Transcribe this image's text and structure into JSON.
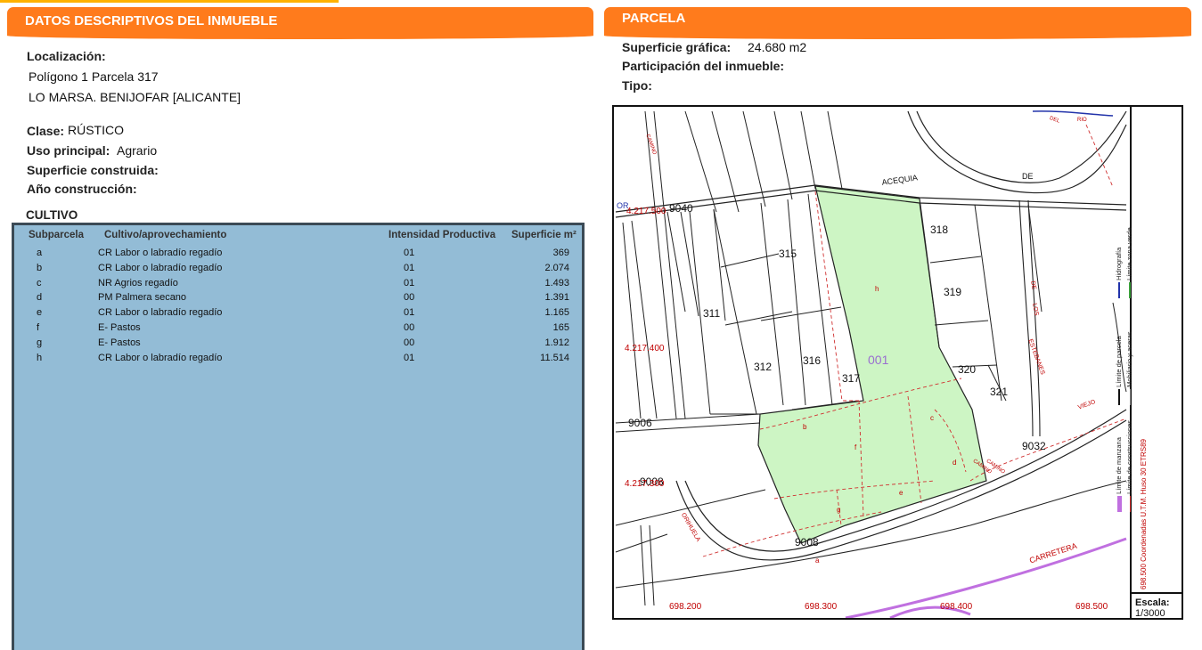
{
  "left_header": "DATOS DESCRIPTIVOS DEL INMUEBLE",
  "right_header": "PARCELA",
  "localizacion": {
    "label": "Localización:",
    "line1": "Polígono 1 Parcela 317",
    "line2": "LO MARSA. BENIJOFAR [ALICANTE]"
  },
  "clase": {
    "label": "Clase:",
    "value": "RÚSTICO"
  },
  "uso": {
    "label": "Uso principal:",
    "value": "Agrario"
  },
  "superficie_construida": {
    "label": "Superficie construida:"
  },
  "ano_construccion": {
    "label": "Año construcción:"
  },
  "cultivo": {
    "title": "CULTIVO",
    "headers": [
      "Subparcela",
      "Cultivo/aprovechamiento",
      "Intensidad Productiva",
      "Superficie m²"
    ],
    "rows": [
      [
        "a",
        "CR Labor o labradío regadío",
        "01",
        "369"
      ],
      [
        "b",
        "CR Labor o labradío regadío",
        "01",
        "2.074"
      ],
      [
        "c",
        "NR Agrios regadío",
        "01",
        "1.493"
      ],
      [
        "d",
        "PM Palmera secano",
        "00",
        "1.391"
      ],
      [
        "e",
        "CR Labor o labradío regadío",
        "01",
        "1.165"
      ],
      [
        "f",
        "E- Pastos",
        "00",
        "165"
      ],
      [
        "g",
        "E- Pastos",
        "00",
        "1.912"
      ],
      [
        "h",
        "CR Labor o labradío regadío",
        "01",
        "11.514"
      ]
    ]
  },
  "parcela": {
    "superficie_label": "Superficie gráfica:",
    "superficie_value": "24.680 m2",
    "participacion_label": "Participación del inmueble:",
    "tipo_label": "Tipo:"
  },
  "map": {
    "parcel_numbers": [
      "311",
      "312",
      "315",
      "316",
      "317",
      "318",
      "319",
      "320",
      "321"
    ],
    "building_code": "001",
    "subparcel_letters": [
      "a",
      "b",
      "c",
      "d",
      "e",
      "f",
      "g",
      "h"
    ],
    "road_codes": [
      "9040",
      "9006",
      "9008",
      "9008",
      "9032"
    ],
    "street_names": [
      "ACEQUIA",
      "DE",
      "CAMINO",
      "CAMINO",
      "DE",
      "LOS",
      "ESTEBANES",
      "VIEJO",
      "CAMINO",
      "CARRETERA",
      "ORIHUELA",
      "DEL",
      "RIO"
    ],
    "y_coords": [
      "4.217.500",
      "4.217.400",
      "4.217.300"
    ],
    "x_coords": [
      "698.200",
      "698.300",
      "698.400",
      "698.500"
    ],
    "y_prefix": "OR",
    "legend": {
      "col1": [
        "Hidrografía",
        "Límite de parcela",
        "Límite de manzana"
      ],
      "col2": [
        "Límite zona verde",
        "Mobiliario y aceras",
        "Límite de construcciones"
      ],
      "coord_system": "698.500 Coordenadas U.T.M. Huso 30 ETRS89",
      "scale_label": "Escala:",
      "scale_value": "1/3000"
    },
    "colors": {
      "parcel_fill": "#cdf5c4",
      "coord_red": "#c00000",
      "road_purple": "#c070e0",
      "water_blue": "#2233aa"
    }
  }
}
